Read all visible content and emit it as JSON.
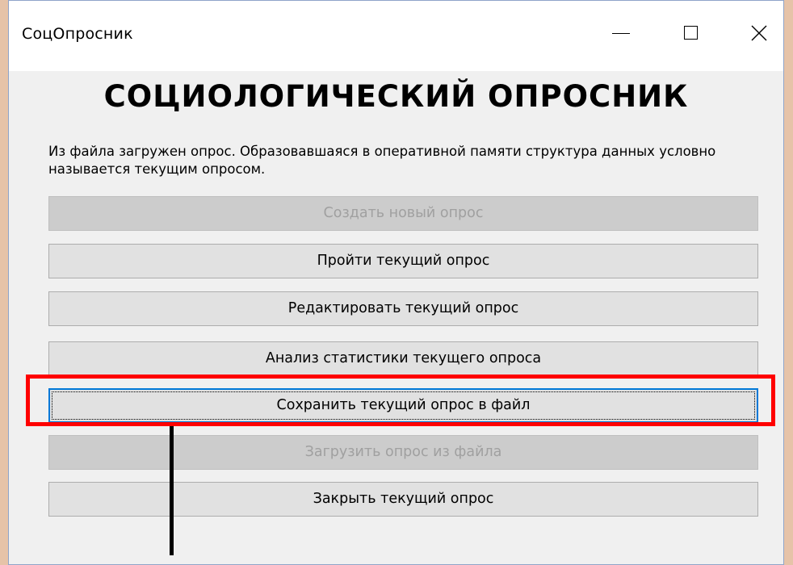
{
  "window": {
    "title": "СоцОпросник"
  },
  "titlebar_controls": {
    "minimize_icon": "minimize-icon",
    "maximize_icon": "maximize-icon",
    "close_icon": "close-icon"
  },
  "main": {
    "heading": "СОЦИОЛОГИЧЕСКИЙ ОПРОСНИК",
    "status": "Из файла загружен опрос. Образовавшаяся в оперативной памяти структура данных условно называется текущим опросом.",
    "buttons": [
      {
        "label": "Создать новый опрос",
        "enabled": false
      },
      {
        "label": "Пройти текущий опрос",
        "enabled": true
      },
      {
        "label": "Редактировать текущий опрос",
        "enabled": true
      },
      {
        "label": "Анализ статистики текущего опроса",
        "enabled": true
      },
      {
        "label": "Сохранить текущий опрос в файл",
        "enabled": true,
        "focused": true
      },
      {
        "label": "Загрузить опрос из файла",
        "enabled": false
      },
      {
        "label": "Закрыть текущий опрос",
        "enabled": true
      }
    ]
  },
  "annotation": {
    "highlight_color": "#ff0000",
    "highlighted_button": "Сохранить текущий опрос в файл"
  }
}
